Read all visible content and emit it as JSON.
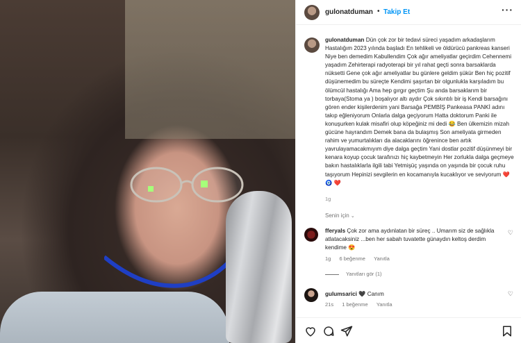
{
  "post": {
    "username": "gulonatduman",
    "follow_label": "Takip Et",
    "separator": "•",
    "more_label": "···"
  },
  "caption": {
    "username": "gulonatduman",
    "text": "Dün çok zor bir tedavi süreci yaşadım arkadaşlarım Hastalığım 2023 yılında başladı En tehlikeli ve öldürücü pankreas kanseri Niye ben demedim Kabullendim Çok ağır ameliyatlar geçirdim Cehennemi yaşadım Zehirterapi radyoterapi bir yıl rahat geçti sonra barsaklarda nüksetti Gene çok ağır ameliyatlar bu günlere geldim şükür Ben hiç pozitif düşünemedim bu süreçte Kendimi şaşırtan bir olgunlukla karşıladım bu ölümcül hastalığı Ama hep gırgır geçtim Şu anda barsaklarım bir torbaya(Stoma ya ) boşalıyor altı aydır Çok sıkıntılı bir iş Kendi barsağını gören ender kişilerdenim yani Barsağa PEMBİŞ Pankeasa PANKİ adını takıp eğleniyorum Onlarla dalga geçiyorum Hatta doktorum Panki ile konuşurken kulak misafiri olup köpeğiniz mi dedi 😂 Ben ülkemizin mizah gücüne hayrandım Demek bana da bulaşmış Son ameliyata girmeden rahim ve yumurtalıkları da alacaklarını öğrenince ben artık yavrulayamacakmıyım diye dalga geçtim Yani dostlar pozitif düşünmeyi bir kenara koyup çocuk tarafınızı hiç kaybetmeyin Her zorlukla dalga geçmeye bakın hastalıklarla ilgili tabi Yetmişüç yaşında on yaşında bir çocuk ruhu taşıyorum Hepinizi sevgilerin en kocamanıyla kucaklıyor ve seviyorum",
    "emojis": "❤️ 🧿 ❤️",
    "time": "1g"
  },
  "for_you_label": "Senin için",
  "comments": [
    {
      "username": "fferyals",
      "text": "Çok zor ama aydınlatan bir süreç .. Umarım siz de sağlıkla atlatacaksiniz ...ben her sabah tuvatette günaydın keltoş derdim kendime 😍",
      "time": "1g",
      "likes": "6 beğenme",
      "reply": "Yanıtla",
      "view_replies": "Yanıtları gör (1)"
    },
    {
      "username": "gulumsarici",
      "text": "🖤 Canım",
      "time": "21s",
      "likes": "1 beğenme",
      "reply": "Yanıtla"
    }
  ],
  "icons": {
    "like": "heart-icon",
    "comment": "comment-icon",
    "share": "share-icon",
    "save": "bookmark-icon"
  },
  "colors": {
    "accent": "#0095f6",
    "text": "#262626",
    "muted": "#737373",
    "heart": "#ed4956"
  }
}
